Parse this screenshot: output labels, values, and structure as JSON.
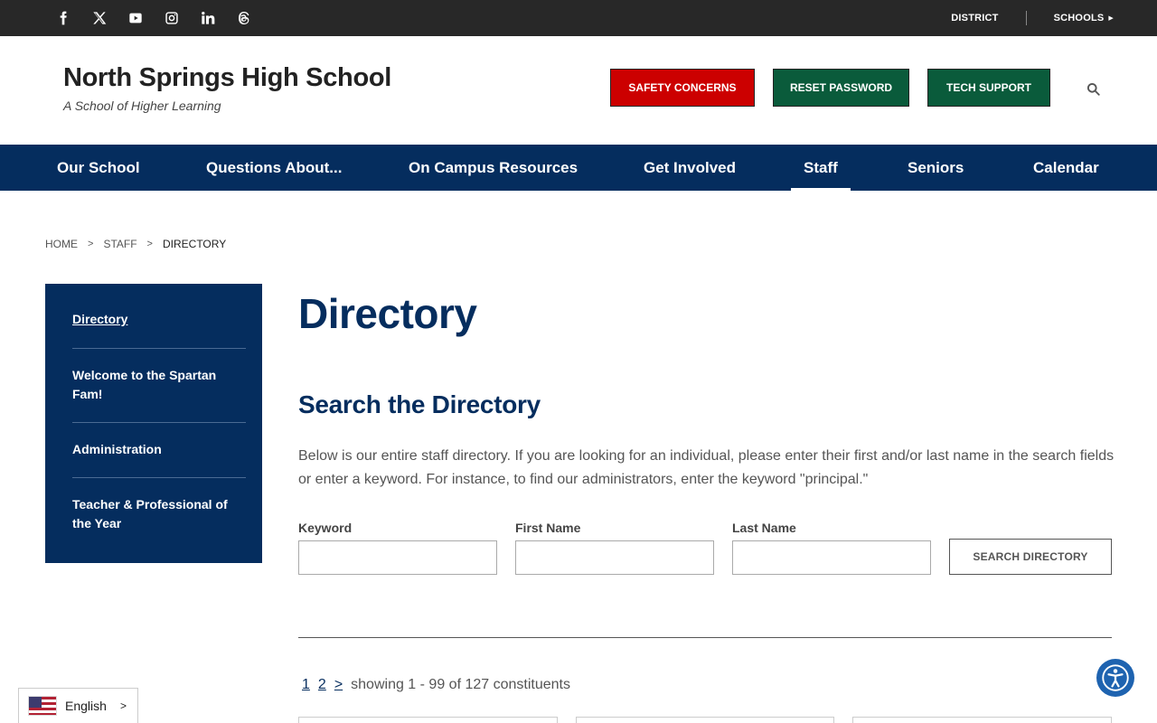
{
  "topbar": {
    "social": [
      {
        "icon": "facebook-icon"
      },
      {
        "icon": "x-twitter-icon"
      },
      {
        "icon": "youtube-icon"
      },
      {
        "icon": "instagram-icon"
      },
      {
        "icon": "linkedin-icon"
      },
      {
        "icon": "threads-icon"
      }
    ],
    "district_label": "DISTRICT",
    "schools_label": "SCHOOLS"
  },
  "header": {
    "school_name": "North Springs High School",
    "tagline": "A School of Higher Learning",
    "buttons": {
      "safety": "SAFETY CONCERNS",
      "reset": "RESET PASSWORD",
      "tech": "TECH SUPPORT"
    }
  },
  "nav": {
    "items": [
      {
        "label": "Our School"
      },
      {
        "label": "Questions About..."
      },
      {
        "label": "On Campus Resources"
      },
      {
        "label": "Get Involved"
      },
      {
        "label": "Staff",
        "active": true
      },
      {
        "label": "Seniors"
      },
      {
        "label": "Calendar"
      }
    ]
  },
  "breadcrumb": {
    "home": "HOME",
    "staff": "STAFF",
    "current": "DIRECTORY"
  },
  "sidebar": {
    "items": [
      {
        "label": "Directory",
        "active": true
      },
      {
        "label": "Welcome to the Spartan Fam!"
      },
      {
        "label": "Administration"
      },
      {
        "label": "Teacher & Professional of the Year"
      }
    ]
  },
  "main": {
    "title": "Directory",
    "section_title": "Search the Directory",
    "intro": "Below is our entire staff directory. If you are looking for an individual, please enter their first and/or last name in the search fields or enter a keyword. For instance, to find our administrators, enter the keyword \"principal.\"",
    "form": {
      "keyword_label": "Keyword",
      "keyword_value": "",
      "first_name_label": "First Name",
      "first_name_value": "",
      "last_name_label": "Last Name",
      "last_name_value": "",
      "submit_label": "SEARCH DIRECTORY"
    },
    "pager": {
      "page1": "1",
      "page2": "2",
      "next": ">",
      "showing": "showing 1 - 99 of 127 constituents"
    }
  },
  "language": {
    "selected": "English"
  },
  "colors": {
    "navy": "#052d5e",
    "red": "#cc0000",
    "green": "#0a5b3b",
    "topbar": "#282828"
  }
}
